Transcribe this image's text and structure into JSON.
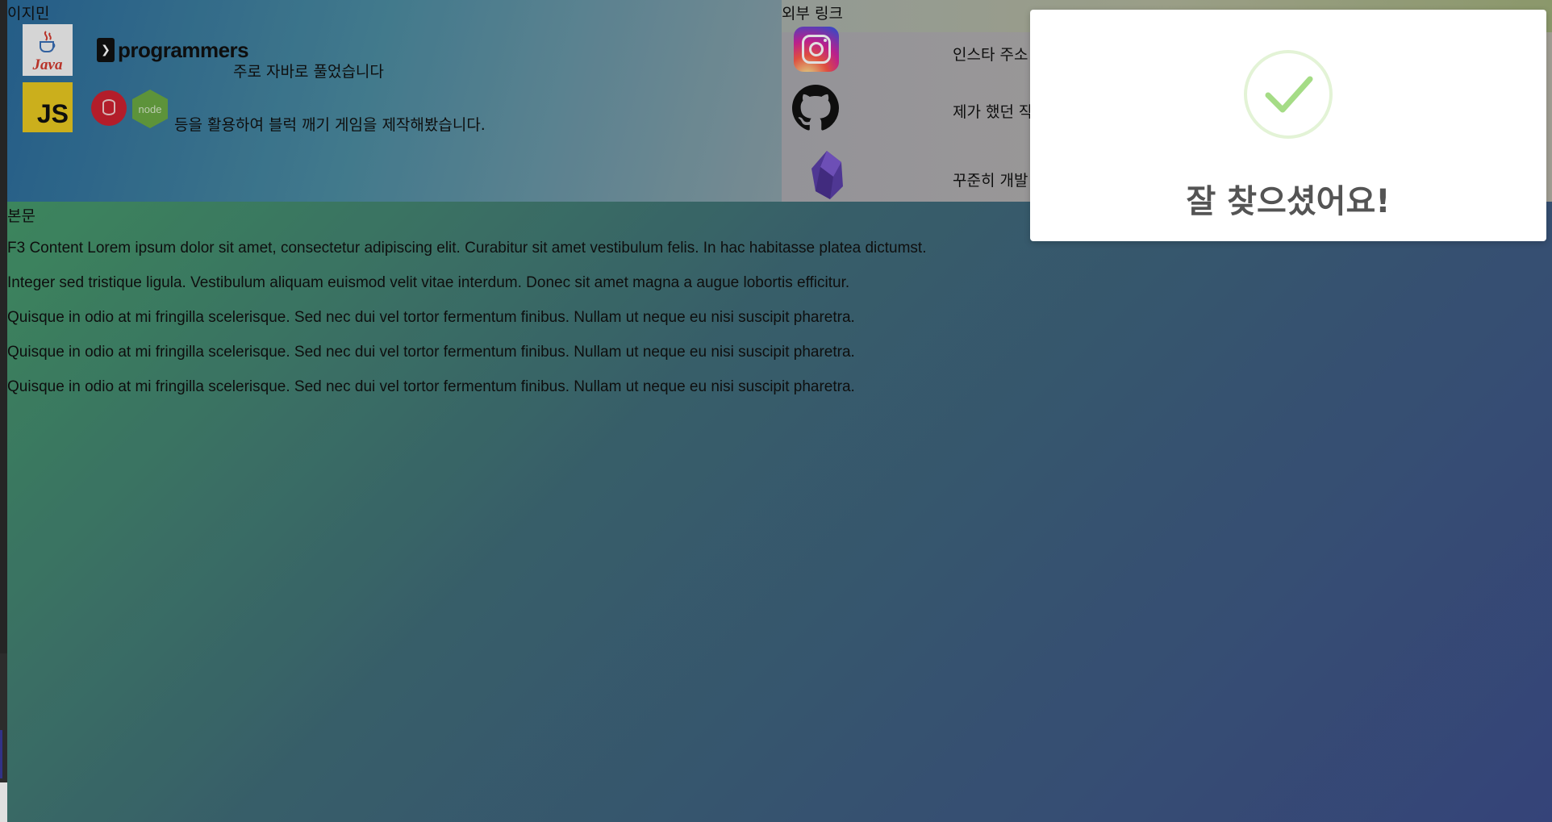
{
  "profile": {
    "title": "이지민",
    "line1": "주로 자바로 풀었습니다",
    "line2": "등을 활용하여 블럭 깨기 게임을 제작해봤습니다.",
    "logos": [
      "java-logo",
      "programmers-logo",
      "javascript-logo",
      "database-logo",
      "nodejs-logo"
    ],
    "java_text": "Java",
    "programmers_text": "programmers",
    "js_text": "JS",
    "node_text": "node"
  },
  "links": {
    "title": "외부 링크",
    "items": [
      {
        "icon": "instagram-icon",
        "text": "인스타 주소"
      },
      {
        "icon": "github-icon",
        "text": "제가 했던 작"
      },
      {
        "icon": "obsidian-icon",
        "text": "꾸준히 개발"
      }
    ]
  },
  "main": {
    "title": "본문",
    "paragraphs": [
      "F3 Content Lorem ipsum dolor sit amet, consectetur adipiscing elit. Curabitur sit amet vestibulum felis. In hac habitasse platea dictumst.",
      "Integer sed tristique ligula. Vestibulum aliquam euismod velit vitae interdum. Donec sit amet magna a augue lobortis efficitur.",
      "Quisque in odio at mi fringilla scelerisque. Sed nec dui vel tortor fermentum finibus. Nullam ut neque eu nisi suscipit pharetra.",
      "Quisque in odio at mi fringilla scelerisque. Sed nec dui vel tortor fermentum finibus. Nullam ut neque eu nisi suscipit pharetra.",
      "Quisque in odio at mi fringilla scelerisque. Sed nec dui vel tortor fermentum finibus. Nullam ut neque eu nisi suscipit pharetra."
    ]
  },
  "popup": {
    "icon": "success-check-icon",
    "message": "잘 찾으셨어요!"
  },
  "colors": {
    "success_ring": "#e3f3d6",
    "success_check": "#a5dc86",
    "popup_text": "#545454"
  }
}
